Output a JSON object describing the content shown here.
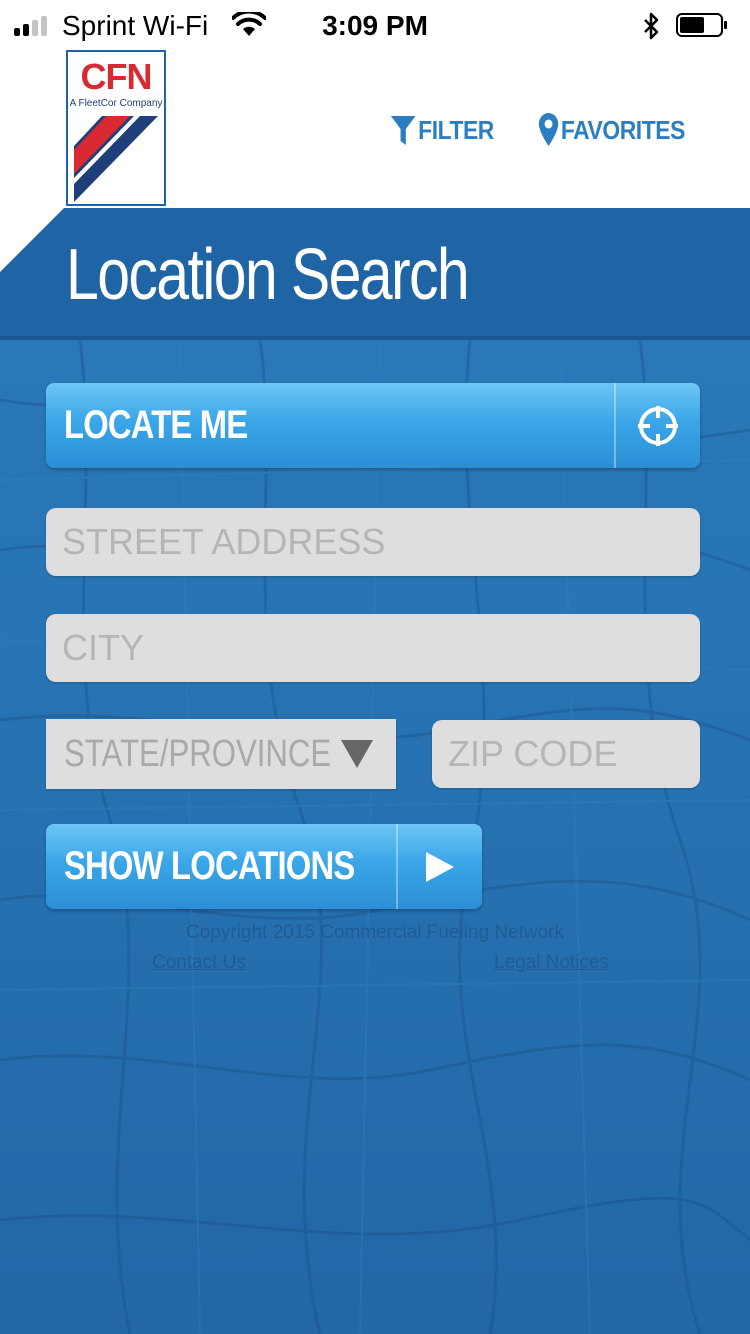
{
  "status_bar": {
    "carrier": "Sprint Wi-Fi",
    "time": "3:09 PM",
    "icons": [
      "signal-icon",
      "wifi-icon",
      "bluetooth-icon",
      "battery-icon"
    ]
  },
  "header": {
    "logo_text": "CFN",
    "logo_subtext": "A FleetCor Company",
    "logo_reg": "®",
    "filter_label": "FILTER",
    "favorites_label": "FAVORITES",
    "link_color": "#2b7fc1"
  },
  "page": {
    "title": "Location Search"
  },
  "form": {
    "locate_label": "LOCATE ME",
    "street_placeholder": "STREET ADDRESS",
    "city_placeholder": "CITY",
    "state_selected": "STATE/PROVINCE",
    "zip_placeholder": "ZIP CODE",
    "show_label": "SHOW LOCATIONS"
  },
  "footer": {
    "copyright": "Copyright 2015 Commercial Fueling Network",
    "contact_link": "Contact Us",
    "legal_link": "Legal Notices"
  },
  "colors": {
    "brand_blue": "#1f65a6",
    "button_blue": "#3aa6e8",
    "logo_red": "#d72a33"
  }
}
